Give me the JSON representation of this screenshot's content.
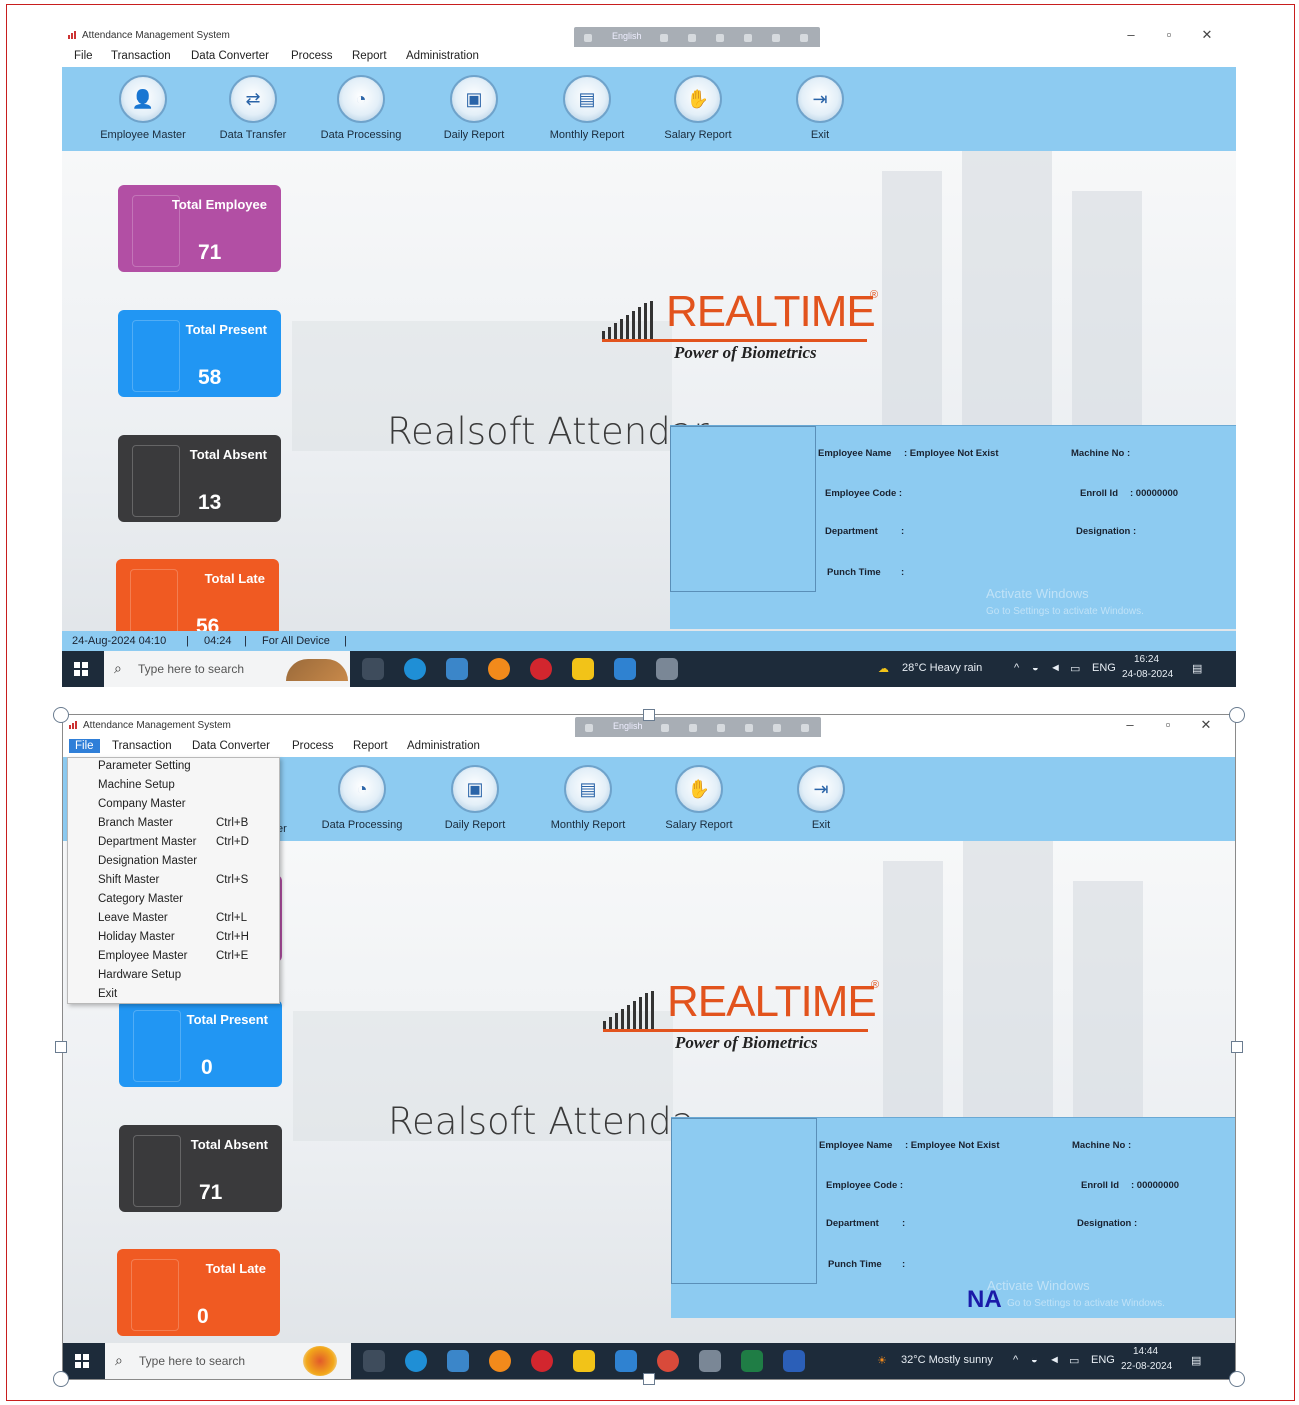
{
  "window_title": "Attendance Management System",
  "menu": [
    "File",
    "Transaction",
    "Data Converter",
    "Process",
    "Report",
    "Administration"
  ],
  "qat_label": "English",
  "toolbar": [
    {
      "label": "Employee Master",
      "icon": "employee-icon"
    },
    {
      "label": "Data Transfer",
      "icon": "transfer-icon"
    },
    {
      "label": "Data Processing",
      "icon": "processing-icon"
    },
    {
      "label": "Daily Report",
      "icon": "daily-report-icon"
    },
    {
      "label": "Monthly Report",
      "icon": "monthly-report-icon"
    },
    {
      "label": "Salary Report",
      "icon": "salary-report-icon"
    },
    {
      "label": "Exit",
      "icon": "exit-icon"
    }
  ],
  "toolbar2_partial_label": "er",
  "cards": {
    "total_employee": "Total Employee",
    "total_present": "Total Present",
    "total_absent": "Total Absent",
    "total_late": "Total Late"
  },
  "screen1": {
    "total_employee": "71",
    "total_present": "58",
    "total_absent": "13",
    "total_late": "56",
    "title_visible": "Realsoft Attendar",
    "status": {
      "datetime": "24-Aug-2024 04:10",
      "time": "04:24",
      "device": "For All Device"
    },
    "weather": "28°C  Heavy rain",
    "clock_time": "16:24",
    "clock_date": "24-08-2024"
  },
  "screen2": {
    "total_present": "0",
    "total_absent": "71",
    "total_late": "0",
    "title_visible": "Realsoft Attenda",
    "na": "NA",
    "weather": "32°C  Mostly sunny",
    "clock_time": "14:44",
    "clock_date": "22-08-2024"
  },
  "logo": {
    "brand": "REALTIME",
    "reg": "®",
    "tagline": "Power of Biometrics"
  },
  "panel": {
    "employee_name_label": "Employee Name",
    "employee_name_value": ": Employee Not Exist",
    "machine_no_label": "Machine No :",
    "employee_code_label": "Employee Code :",
    "enroll_id_label": "Enroll Id",
    "enroll_id_value": ":  00000000",
    "department_label": "Department",
    "designation_label": "Designation :",
    "punch_time_label": "Punch Time",
    "colon": ":"
  },
  "watermark": {
    "line1": "Activate Windows",
    "line2": "Go to Settings to activate Windows."
  },
  "taskbar": {
    "search_placeholder": "Type here to search",
    "lang": "ENG"
  },
  "file_menu": [
    {
      "label": "Parameter Setting",
      "shortcut": ""
    },
    {
      "label": "Machine Setup",
      "shortcut": ""
    },
    {
      "label": "Company Master",
      "shortcut": ""
    },
    {
      "label": "Branch Master",
      "shortcut": "Ctrl+B"
    },
    {
      "label": "Department Master",
      "shortcut": "Ctrl+D"
    },
    {
      "label": "Designation Master",
      "shortcut": ""
    },
    {
      "label": "Shift Master",
      "shortcut": "Ctrl+S"
    },
    {
      "label": "Category Master",
      "shortcut": ""
    },
    {
      "label": "Leave Master",
      "shortcut": "Ctrl+L"
    },
    {
      "label": "Holiday Master",
      "shortcut": "Ctrl+H"
    },
    {
      "label": "Employee Master",
      "shortcut": "Ctrl+E"
    },
    {
      "label": "Hardware Setup",
      "shortcut": ""
    },
    {
      "label": "Exit",
      "shortcut": ""
    }
  ],
  "colors": {
    "toolbar": "#8dcbf1",
    "purple": "#b24fa4",
    "blue": "#2196f3",
    "dark": "#3a3a3c",
    "orange": "#f05a22",
    "brand": "#e2531d",
    "border": "#c81e1e"
  }
}
